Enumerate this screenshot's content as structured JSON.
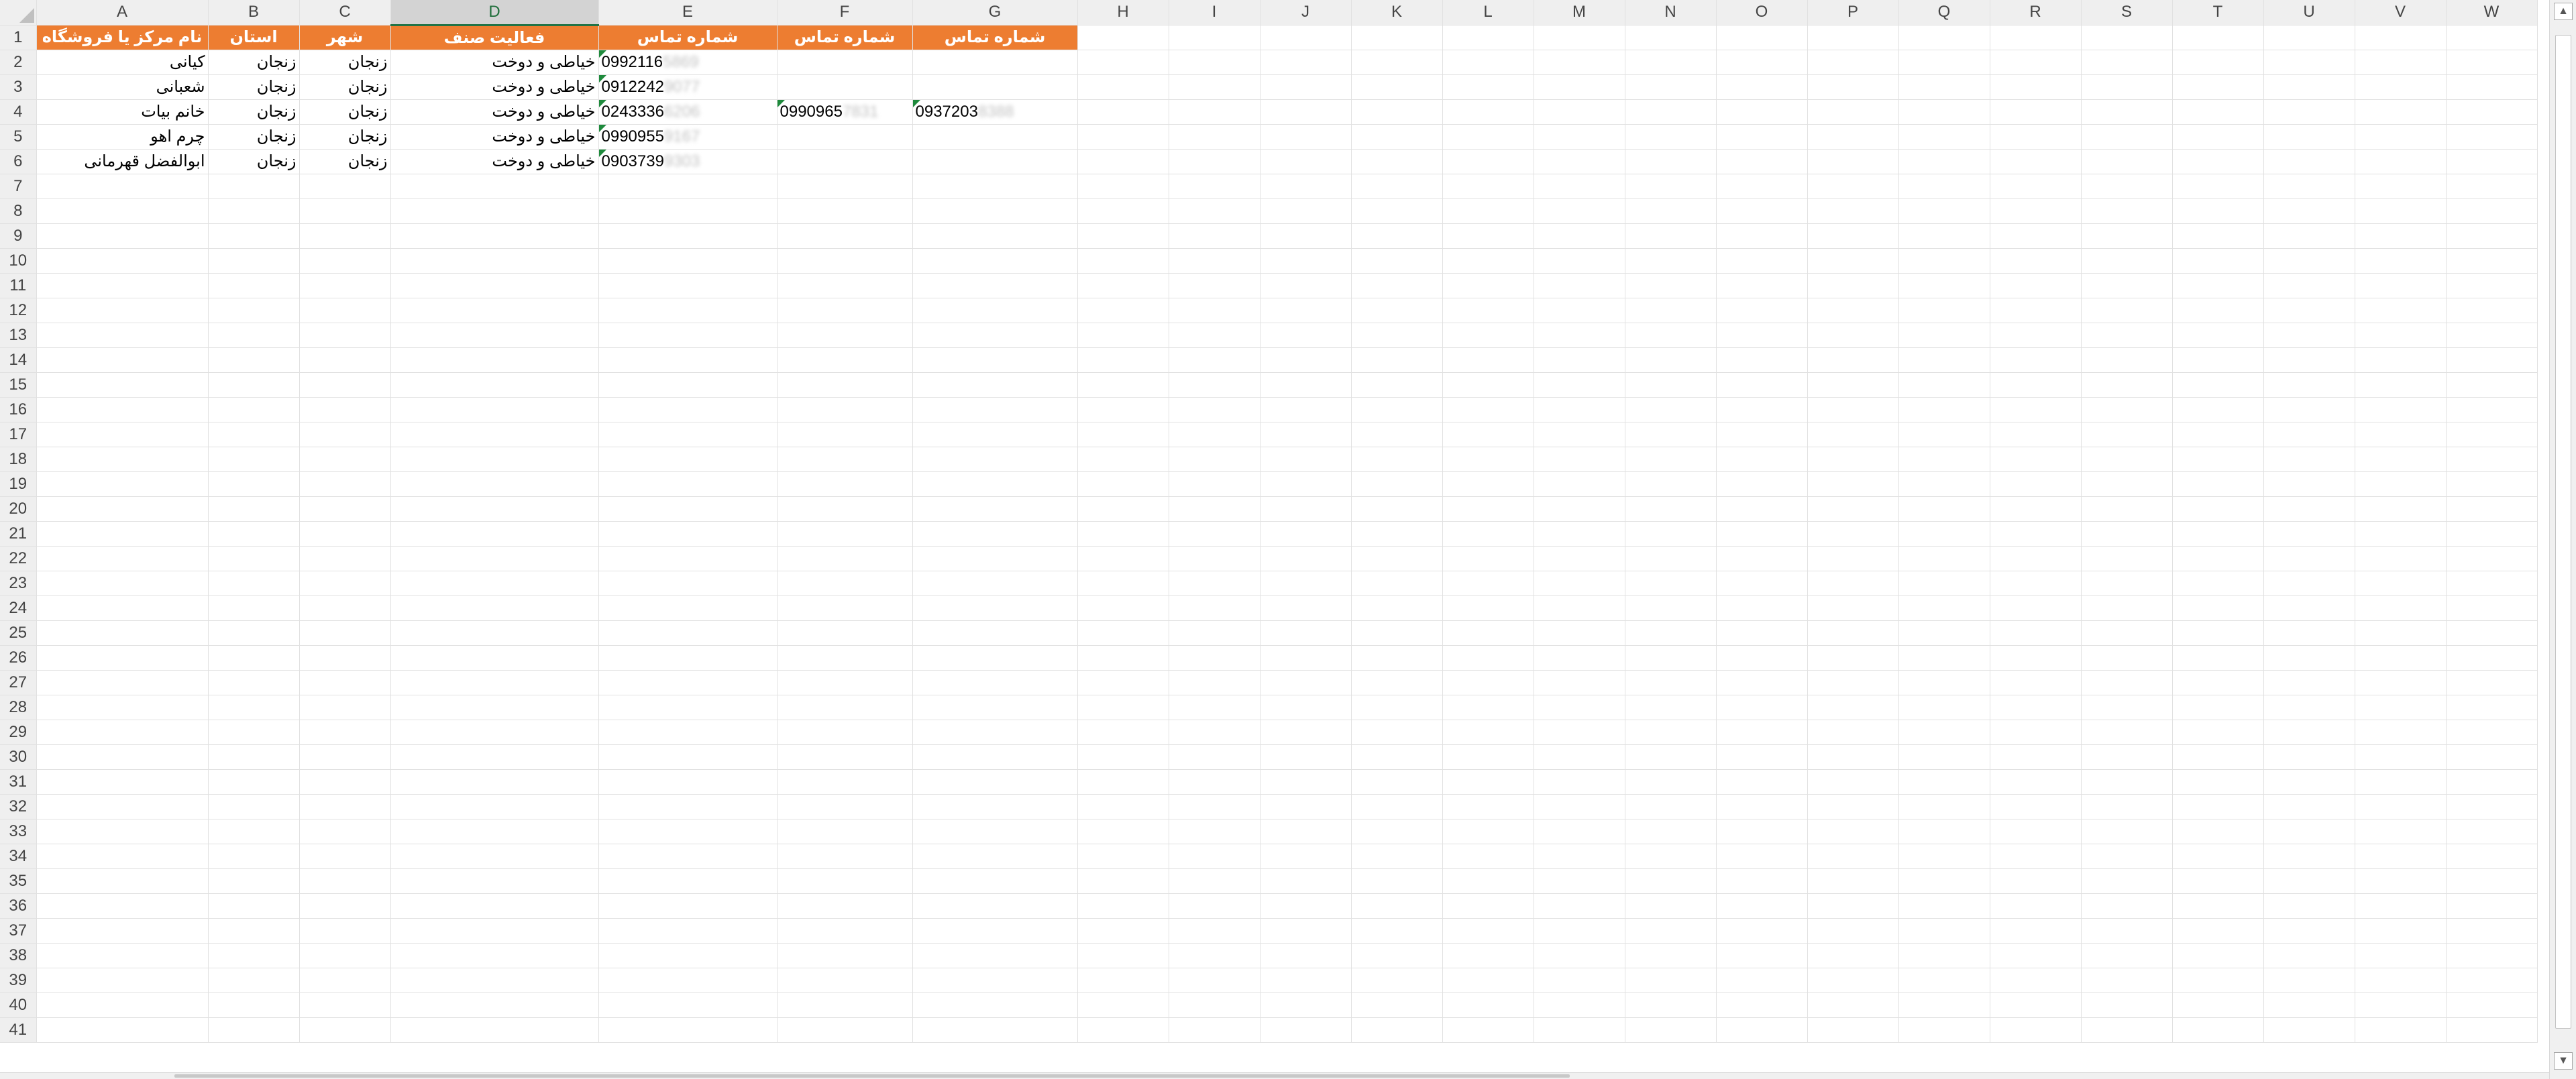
{
  "columns": [
    "A",
    "B",
    "C",
    "D",
    "E",
    "F",
    "G",
    "H",
    "I",
    "J",
    "K",
    "L",
    "M",
    "N",
    "O",
    "P",
    "Q",
    "R",
    "S",
    "T",
    "U",
    "V",
    "W"
  ],
  "selected_column": "D",
  "rows_total": 41,
  "header_row": {
    "A": "نام مرکز یا فروشگاه",
    "B": "استان",
    "C": "شهر",
    "D": "فعالیت صنف",
    "E": "شماره تماس",
    "F": "شماره تماس",
    "G": "شماره تماس"
  },
  "data_rows": [
    {
      "name": "کیانی",
      "province": "زنجان",
      "city": "زنجان",
      "activity": "خیاطی و دوخت",
      "phone1": {
        "visible": "0992116",
        "hidden": "5869"
      }
    },
    {
      "name": "شعبانی",
      "province": "زنجان",
      "city": "زنجان",
      "activity": "خیاطی و دوخت",
      "phone1": {
        "visible": "0912242",
        "hidden": "9077"
      }
    },
    {
      "name": "خانم بیات",
      "province": "زنجان",
      "city": "زنجان",
      "activity": "خیاطی و دوخت",
      "phone1": {
        "visible": "0243336",
        "hidden": "6206"
      },
      "phone2": {
        "visible": "0990965",
        "hidden": "7831"
      },
      "phone3": {
        "visible": "0937203",
        "hidden": "8388"
      }
    },
    {
      "name": "چرم اهو",
      "province": "زنجان",
      "city": "زنجان",
      "activity": "خیاطی و دوخت",
      "phone1": {
        "visible": "0990955",
        "hidden": "9167"
      }
    },
    {
      "name": "ابوالفضل قهرمانی",
      "province": "زنجان",
      "city": "زنجان",
      "activity": "خیاطی و دوخت",
      "phone1": {
        "visible": "0903739",
        "hidden": "9303"
      }
    }
  ],
  "colors": {
    "header_fill": "#ed7d31",
    "header_text": "#ffffff",
    "excel_green": "#217346"
  }
}
